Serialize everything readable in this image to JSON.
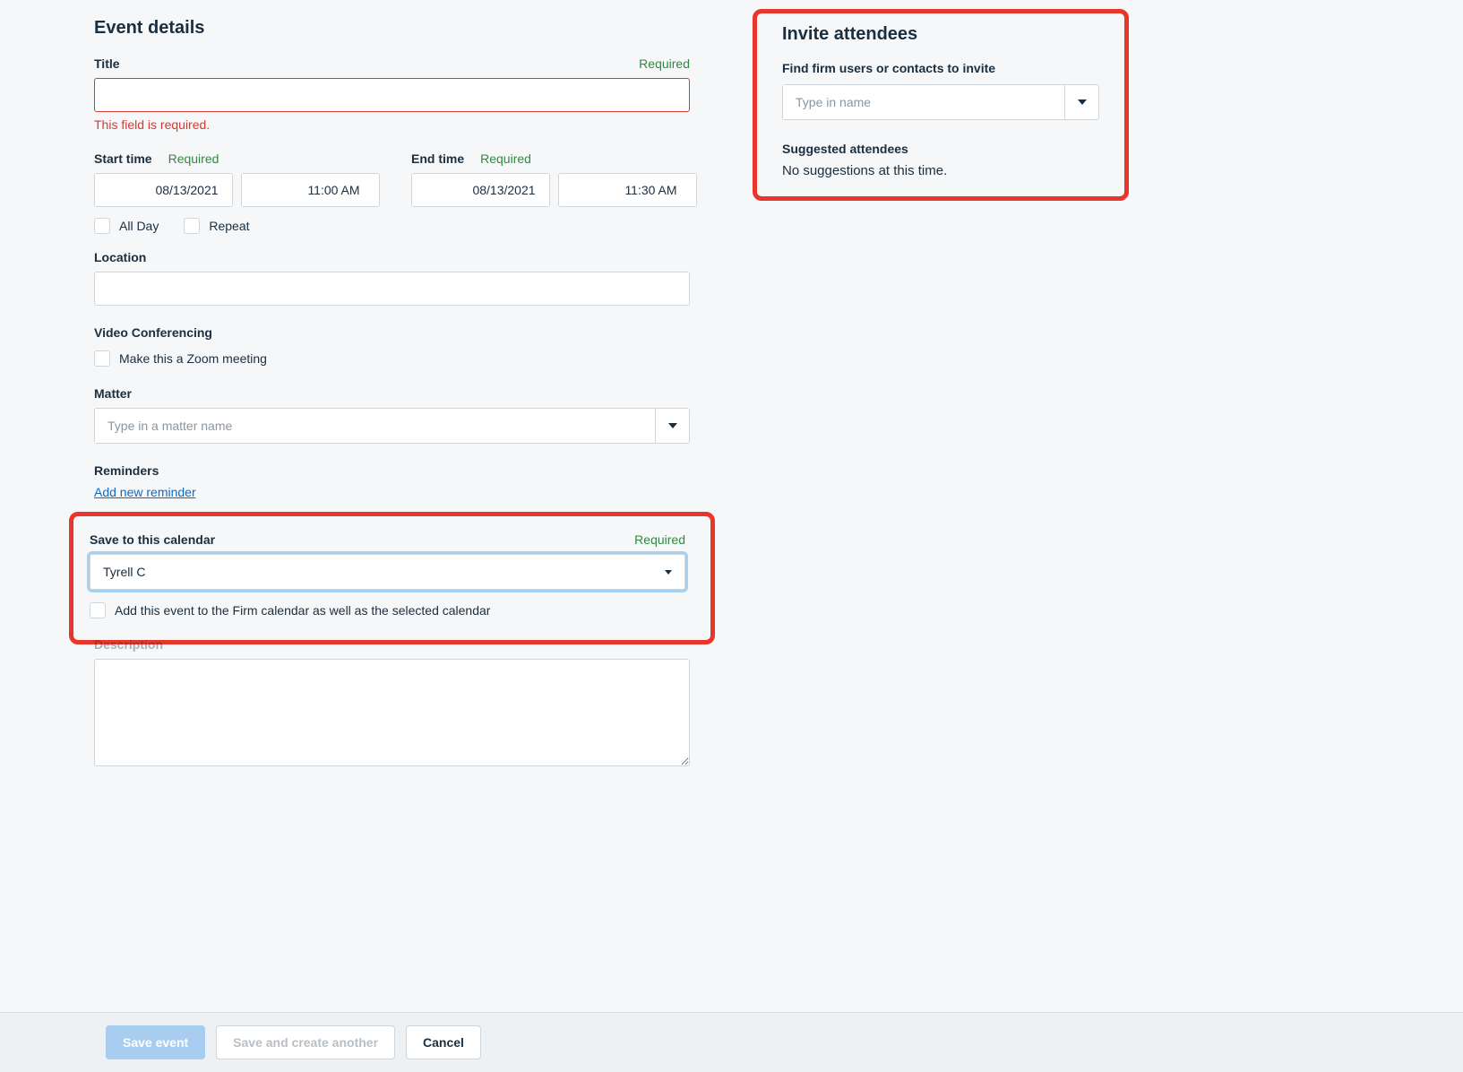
{
  "eventDetails": {
    "heading": "Event details",
    "title": {
      "label": "Title",
      "required": "Required",
      "value": "",
      "error": "This field is required."
    },
    "startTime": {
      "label": "Start time",
      "required": "Required",
      "date": "08/13/2021",
      "time": "11:00 AM"
    },
    "endTime": {
      "label": "End time",
      "required": "Required",
      "date": "08/13/2021",
      "time": "11:30 AM"
    },
    "allDay": {
      "label": "All Day",
      "checked": false
    },
    "repeat": {
      "label": "Repeat",
      "checked": false
    },
    "location": {
      "label": "Location",
      "value": ""
    },
    "videoConferencing": {
      "label": "Video Conferencing",
      "zoomLabel": "Make this a Zoom meeting",
      "zoomChecked": false
    },
    "matter": {
      "label": "Matter",
      "placeholder": "Type in a matter name",
      "value": ""
    },
    "reminders": {
      "label": "Reminders",
      "addLink": "Add new reminder"
    },
    "saveToCalendar": {
      "label": "Save to this calendar",
      "required": "Required",
      "value": "Tyrell C",
      "firmCalendarLabel": "Add this event to the Firm calendar as well as the selected calendar",
      "firmCalendarChecked": false
    },
    "description": {
      "label": "Description",
      "value": ""
    }
  },
  "inviteAttendees": {
    "heading": "Invite attendees",
    "findLabel": "Find firm users or contacts to invite",
    "placeholder": "Type in name",
    "suggestedLabel": "Suggested attendees",
    "noSuggestions": "No suggestions at this time."
  },
  "footer": {
    "saveEvent": "Save event",
    "saveAndCreate": "Save and create another",
    "cancel": "Cancel"
  }
}
